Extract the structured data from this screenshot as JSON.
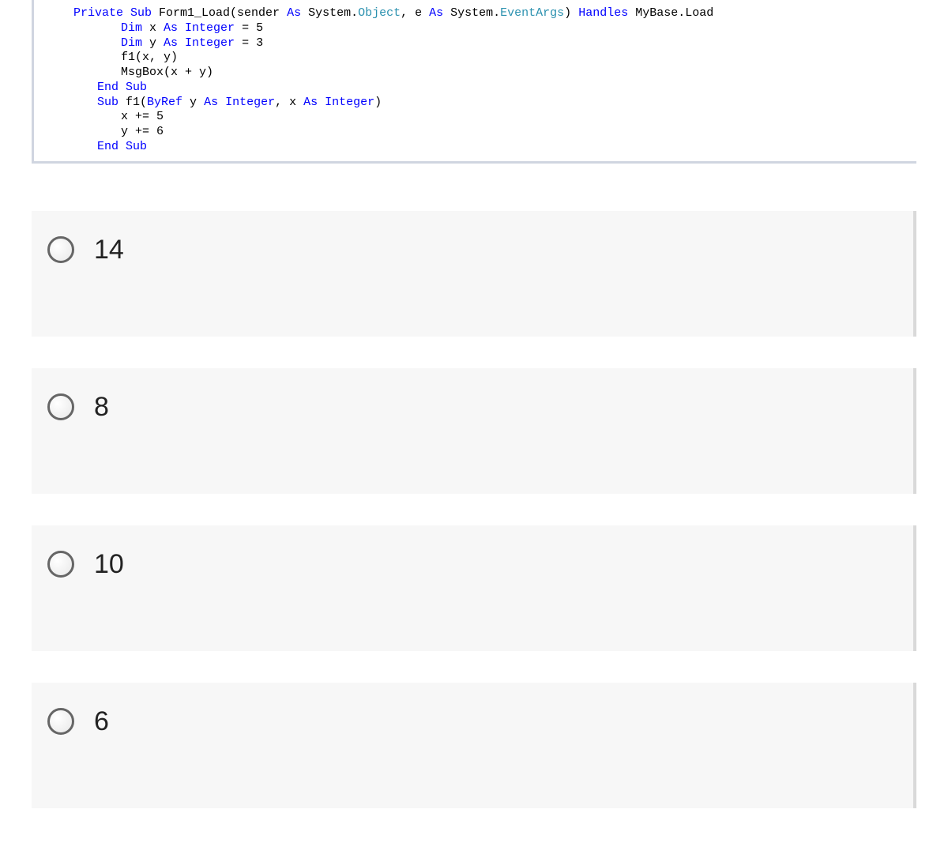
{
  "code": {
    "line1_a": "Private",
    "line1_b": " Sub",
    "line1_c": " Form1_Load(sender ",
    "line1_d": "As",
    "line1_e": " System.",
    "line1_f": "Object",
    "line1_g": ", e ",
    "line1_h": "As",
    "line1_i": " System.",
    "line1_j": "EventArgs",
    "line1_k": ") ",
    "line1_l": "Handles",
    "line1_m": " MyBase.Load",
    "line2_a": "Dim",
    "line2_b": " x ",
    "line2_c": "As",
    "line2_d": " Integer",
    "line2_e": " = 5",
    "line3_a": "Dim",
    "line3_b": " y ",
    "line3_c": "As",
    "line3_d": " Integer",
    "line3_e": " = 3",
    "line4": "f1(x, y)",
    "line5": "MsgBox(x + y)",
    "line6_a": "End",
    "line6_b": " Sub",
    "line7_a": "Sub",
    "line7_b": " f1(",
    "line7_c": "ByRef",
    "line7_d": " y ",
    "line7_e": "As",
    "line7_f": " Integer",
    "line7_g": ", x ",
    "line7_h": "As",
    "line7_i": " Integer",
    "line7_j": ")",
    "line8": "x += 5",
    "line9": "y += 6",
    "line10_a": "End",
    "line10_b": " Sub"
  },
  "options": [
    {
      "label": "14"
    },
    {
      "label": "8"
    },
    {
      "label": "10"
    },
    {
      "label": "6"
    }
  ]
}
